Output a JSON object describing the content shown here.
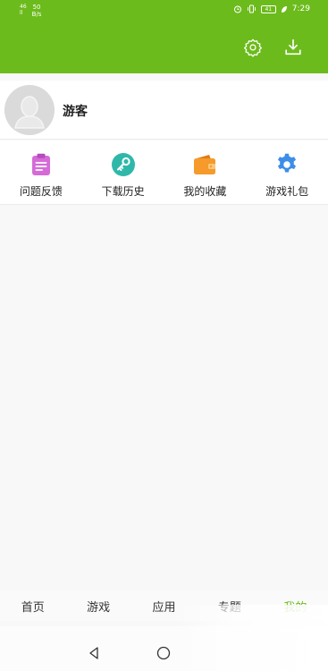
{
  "status_bar": {
    "signal": "46",
    "signal2": "ll",
    "speed_value": "50",
    "speed_unit": "B/s",
    "time": "7:29",
    "battery": "41"
  },
  "header": {
    "settings_icon": "gear-icon",
    "download_icon": "download-icon",
    "bg_color": "#6cbb1c"
  },
  "profile": {
    "username": "游客"
  },
  "shortcuts": [
    {
      "label": "问题反馈",
      "icon": "clipboard-icon",
      "color": "#d56bd8"
    },
    {
      "label": "下载历史",
      "icon": "key-icon",
      "color": "#2fb8a9"
    },
    {
      "label": "我的收藏",
      "icon": "wallet-icon",
      "color": "#f59a2b"
    },
    {
      "label": "游戏礼包",
      "icon": "gear-icon",
      "color": "#3d8ee8"
    }
  ],
  "tabs": [
    {
      "label": "首页"
    },
    {
      "label": "游戏"
    },
    {
      "label": "应用"
    },
    {
      "label": "专题"
    },
    {
      "label": "我的",
      "active": true
    }
  ],
  "accent_color": "#6cbb1c"
}
